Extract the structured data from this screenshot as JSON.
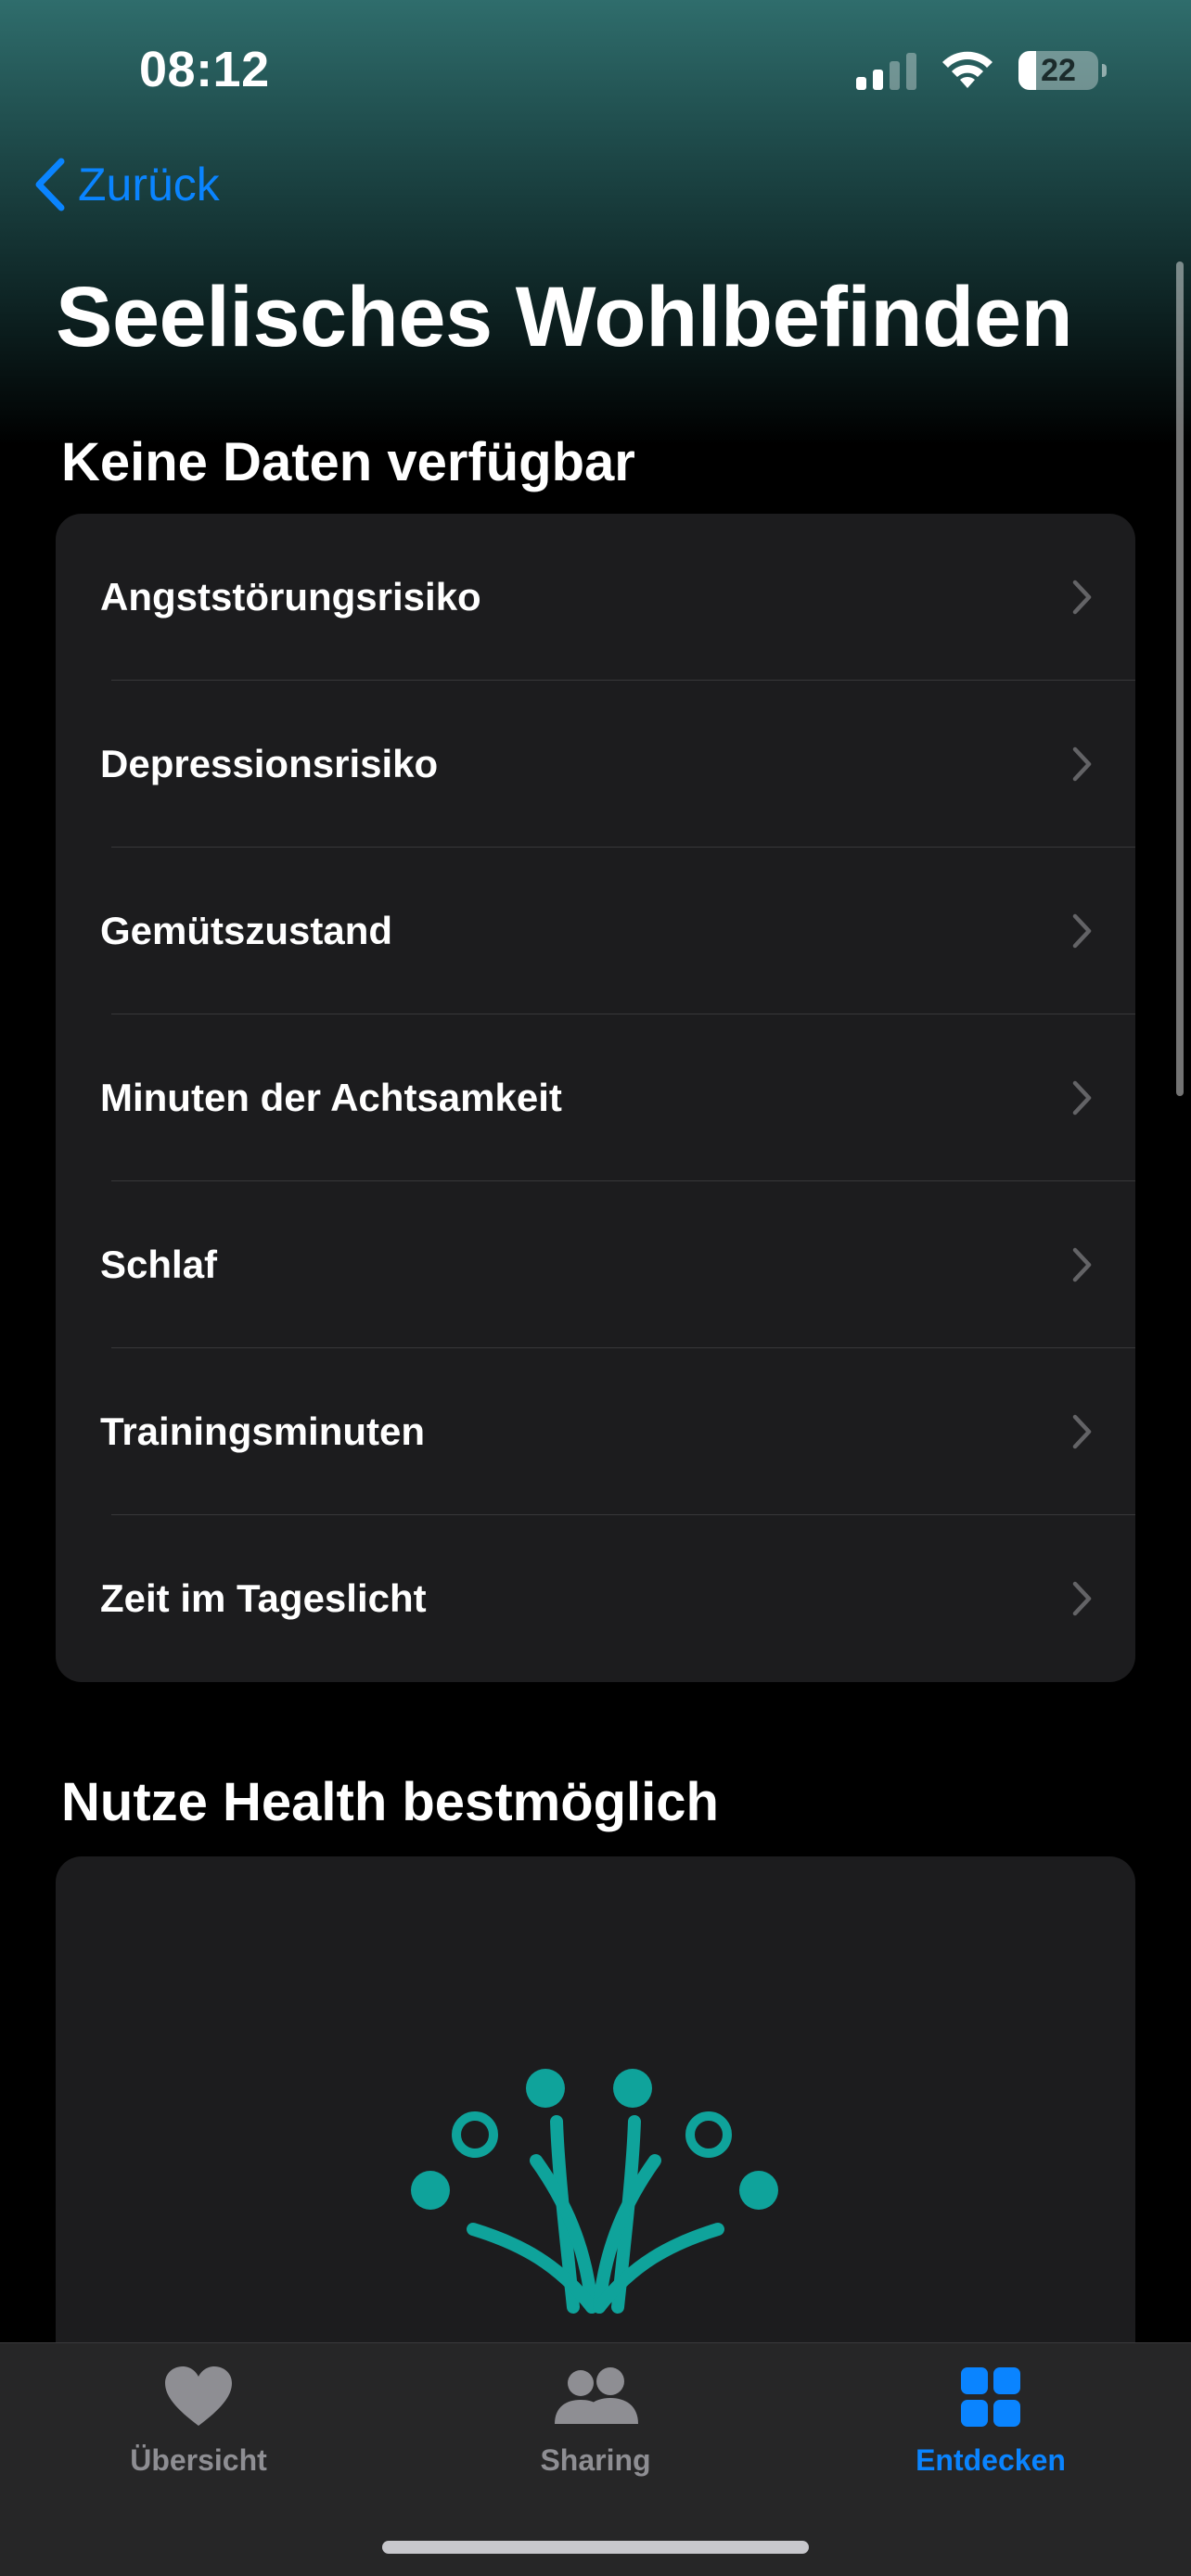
{
  "status_bar": {
    "time": "08:12",
    "battery_level": "22",
    "signal_bars_active": 2,
    "signal_bars_total": 4
  },
  "nav": {
    "back_label": "Zurück"
  },
  "page": {
    "title": "Seelisches Wohlbefinden"
  },
  "sections": {
    "no_data_heading": "Keine Daten verfügbar",
    "items": [
      {
        "label": "Angststörungsrisiko"
      },
      {
        "label": "Depressionsrisiko"
      },
      {
        "label": "Gemütszustand"
      },
      {
        "label": "Minuten der Achtsamkeit"
      },
      {
        "label": "Schlaf"
      },
      {
        "label": "Trainingsminuten"
      },
      {
        "label": "Zeit im Tageslicht"
      }
    ],
    "promo_heading": "Nutze Health bestmöglich"
  },
  "tab_bar": {
    "tabs": [
      {
        "label": "Übersicht",
        "icon": "heart-icon",
        "active": false
      },
      {
        "label": "Sharing",
        "icon": "people-icon",
        "active": false
      },
      {
        "label": "Entdecken",
        "icon": "grid-icon",
        "active": true
      }
    ]
  },
  "colors": {
    "accent": "#0a84ff",
    "card_background": "#1c1c1e",
    "illustration_teal": "#0fa39b",
    "header_gradient_top": "#2f6d6c"
  }
}
